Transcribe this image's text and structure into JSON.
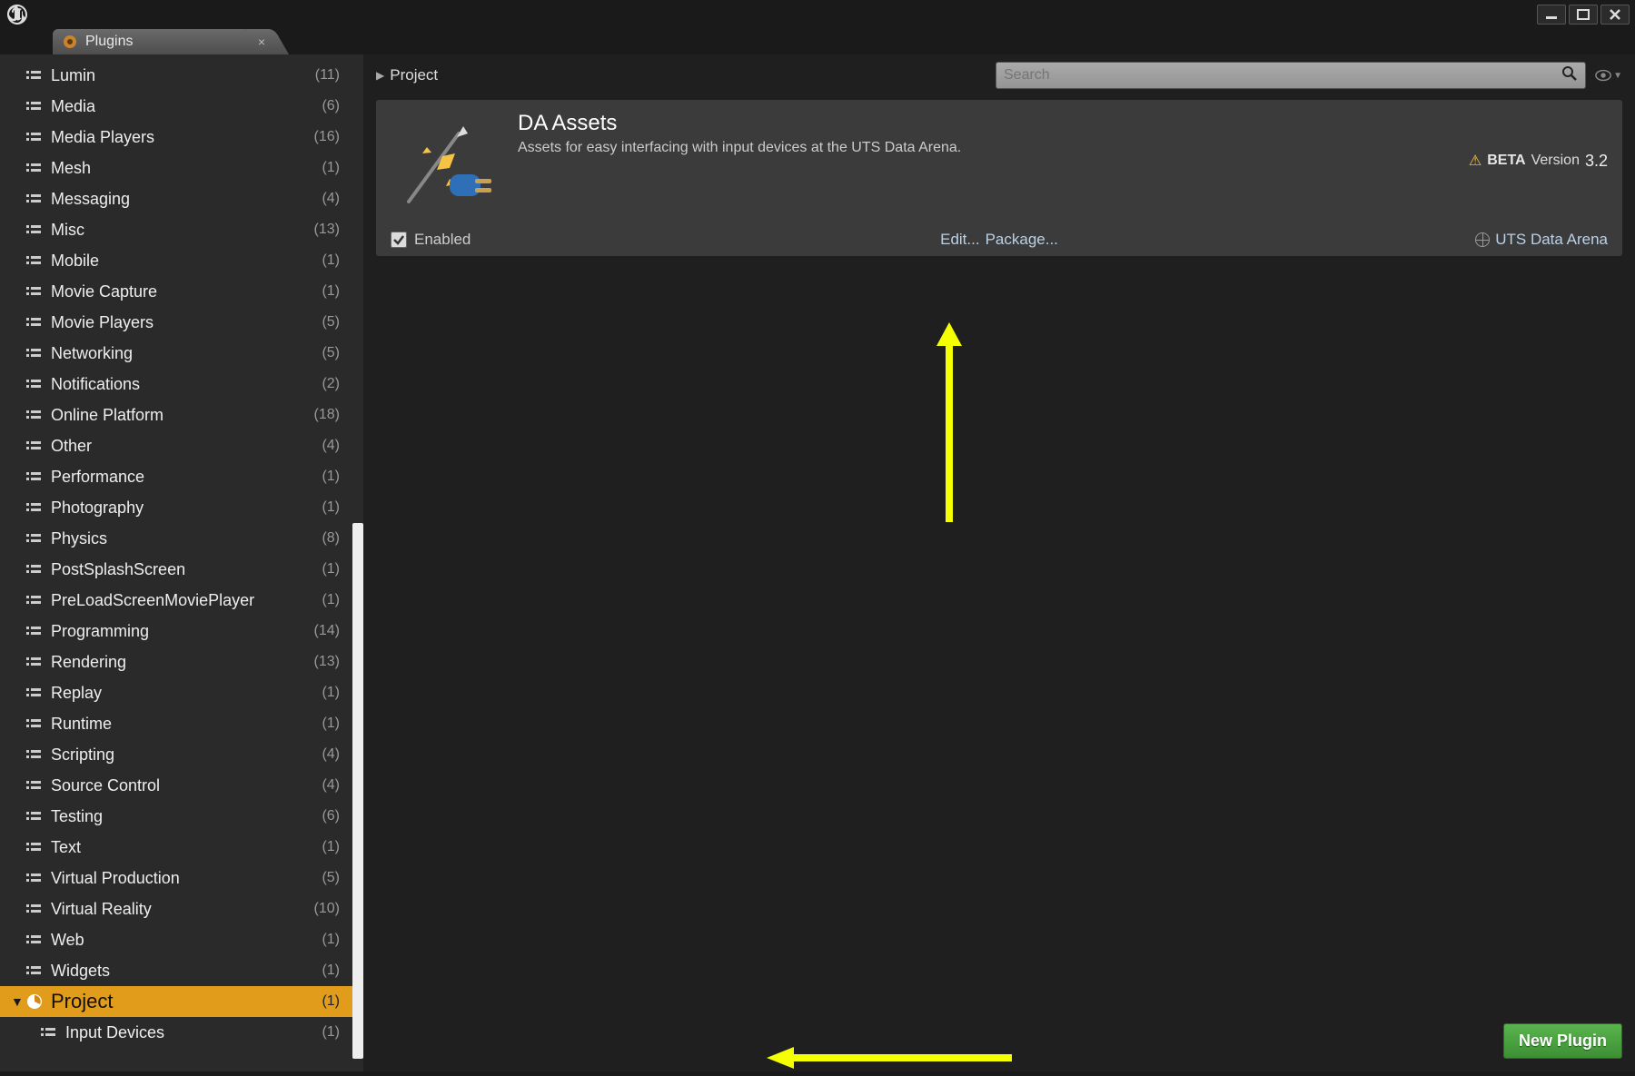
{
  "window": {
    "tab_title": "Plugins"
  },
  "sidebar": {
    "items": [
      {
        "label": "Lumin",
        "count": "(11)"
      },
      {
        "label": "Media",
        "count": "(6)"
      },
      {
        "label": "Media Players",
        "count": "(16)"
      },
      {
        "label": "Mesh",
        "count": "(1)"
      },
      {
        "label": "Messaging",
        "count": "(4)"
      },
      {
        "label": "Misc",
        "count": "(13)"
      },
      {
        "label": "Mobile",
        "count": "(1)"
      },
      {
        "label": "Movie Capture",
        "count": "(1)"
      },
      {
        "label": "Movie Players",
        "count": "(5)"
      },
      {
        "label": "Networking",
        "count": "(5)"
      },
      {
        "label": "Notifications",
        "count": "(2)"
      },
      {
        "label": "Online Platform",
        "count": "(18)"
      },
      {
        "label": "Other",
        "count": "(4)"
      },
      {
        "label": "Performance",
        "count": "(1)"
      },
      {
        "label": "Photography",
        "count": "(1)"
      },
      {
        "label": "Physics",
        "count": "(8)"
      },
      {
        "label": "PostSplashScreen",
        "count": "(1)"
      },
      {
        "label": "PreLoadScreenMoviePlayer",
        "count": "(1)"
      },
      {
        "label": "Programming",
        "count": "(14)"
      },
      {
        "label": "Rendering",
        "count": "(13)"
      },
      {
        "label": "Replay",
        "count": "(1)"
      },
      {
        "label": "Runtime",
        "count": "(1)"
      },
      {
        "label": "Scripting",
        "count": "(4)"
      },
      {
        "label": "Source Control",
        "count": "(4)"
      },
      {
        "label": "Testing",
        "count": "(6)"
      },
      {
        "label": "Text",
        "count": "(1)"
      },
      {
        "label": "Virtual Production",
        "count": "(5)"
      },
      {
        "label": "Virtual Reality",
        "count": "(10)"
      },
      {
        "label": "Web",
        "count": "(1)"
      },
      {
        "label": "Widgets",
        "count": "(1)"
      }
    ],
    "selected": {
      "label": "Project",
      "count": "(1)"
    },
    "child": {
      "label": "Input Devices",
      "count": "(1)"
    }
  },
  "breadcrumb": {
    "root": "Project"
  },
  "search": {
    "placeholder": "Search"
  },
  "plugin": {
    "title": "DA Assets",
    "desc": "Assets for easy interfacing with input devices at the UTS Data Arena.",
    "beta": "BETA",
    "version_label": "Version",
    "version": "3.2",
    "enabled_label": "Enabled",
    "edit": "Edit...",
    "package": "Package...",
    "vendor": "UTS Data Arena"
  },
  "buttons": {
    "new_plugin": "New Plugin"
  }
}
